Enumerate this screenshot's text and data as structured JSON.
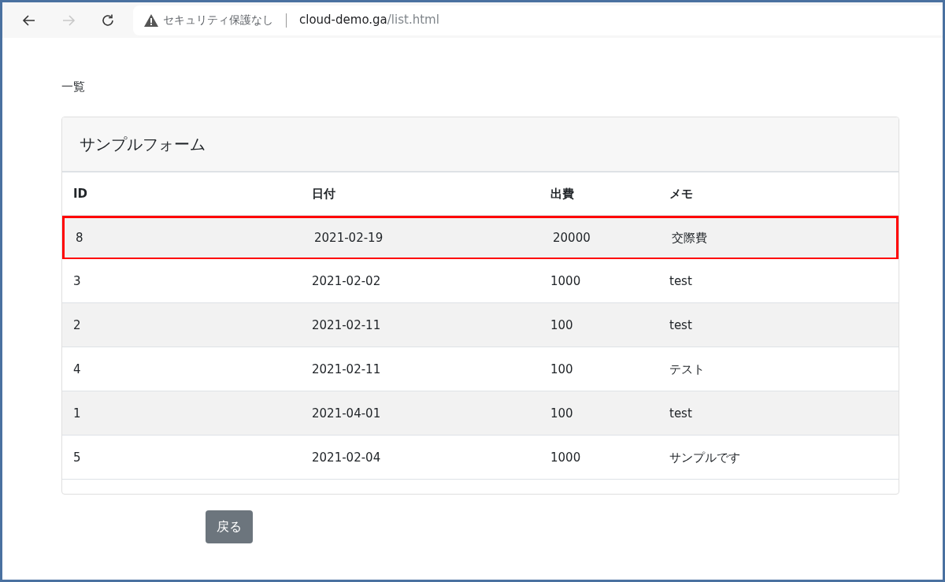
{
  "browser": {
    "security_label": "セキュリティ保護なし",
    "url_host": "cloud-demo.ga",
    "url_path": "/list.html",
    "forward_disabled": true
  },
  "page": {
    "heading": "一覧",
    "card_title": "サンプルフォーム",
    "table": {
      "columns": [
        "ID",
        "日付",
        "出費",
        "メモ"
      ],
      "rows": [
        {
          "cells": [
            "8",
            "2021-02-19",
            "20000",
            "交際費"
          ],
          "highlighted": true
        },
        {
          "cells": [
            "3",
            "2021-02-02",
            "1000",
            "test"
          ],
          "highlighted": false
        },
        {
          "cells": [
            "2",
            "2021-02-11",
            "100",
            "test"
          ],
          "highlighted": false
        },
        {
          "cells": [
            "4",
            "2021-02-11",
            "100",
            "テスト"
          ],
          "highlighted": false
        },
        {
          "cells": [
            "1",
            "2021-04-01",
            "100",
            "test"
          ],
          "highlighted": false
        },
        {
          "cells": [
            "5",
            "2021-02-04",
            "1000",
            "サンプルです"
          ],
          "highlighted": false
        }
      ]
    },
    "back_button": "戻る"
  }
}
